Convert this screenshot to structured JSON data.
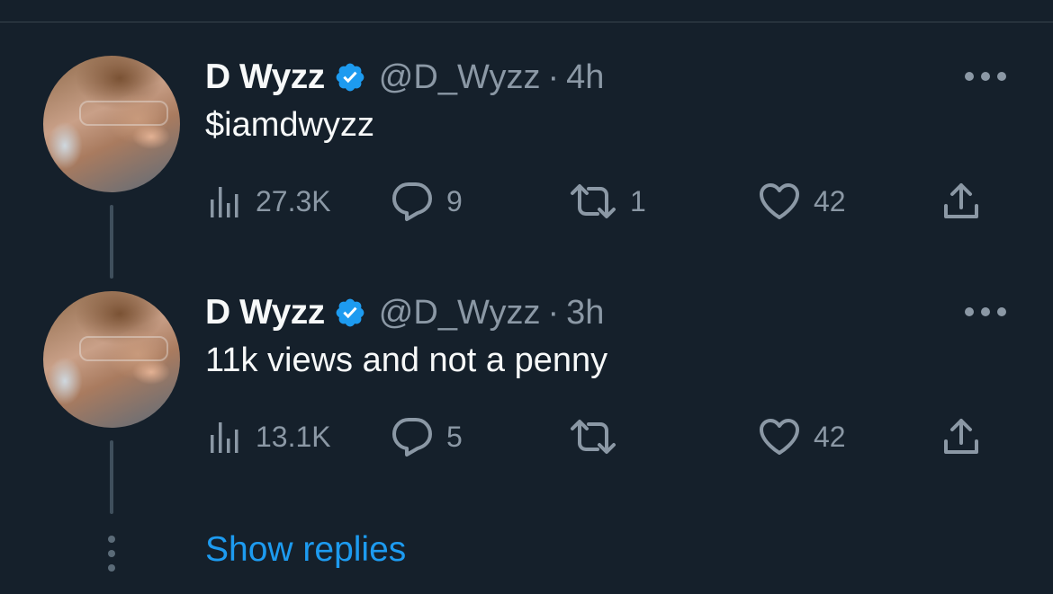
{
  "colors": {
    "background": "#15202b",
    "primary_text": "#f7f9f9",
    "secondary_text": "#8b98a5",
    "accent": "#1d9bf0"
  },
  "tweets": [
    {
      "author_name": "D Wyzz",
      "handle": "@D_Wyzz",
      "separator": "·",
      "time": "4h",
      "text": "$iamdwyzz",
      "views": "27.3K",
      "replies": "9",
      "retweets": "1",
      "likes": "42",
      "icons": [
        "avatar",
        "verified-badge-icon",
        "more-icon",
        "views-icon",
        "reply-icon",
        "retweet-icon",
        "like-icon",
        "share-icon"
      ]
    },
    {
      "author_name": "D Wyzz",
      "handle": "@D_Wyzz",
      "separator": "·",
      "time": "3h",
      "text": "11k views and not a penny",
      "views": "13.1K",
      "replies": "5",
      "retweets": "",
      "likes": "42",
      "icons": [
        "avatar",
        "verified-badge-icon",
        "more-icon",
        "views-icon",
        "reply-icon",
        "retweet-icon",
        "like-icon",
        "share-icon"
      ]
    }
  ],
  "thread": {
    "show_replies_label": "Show replies"
  }
}
